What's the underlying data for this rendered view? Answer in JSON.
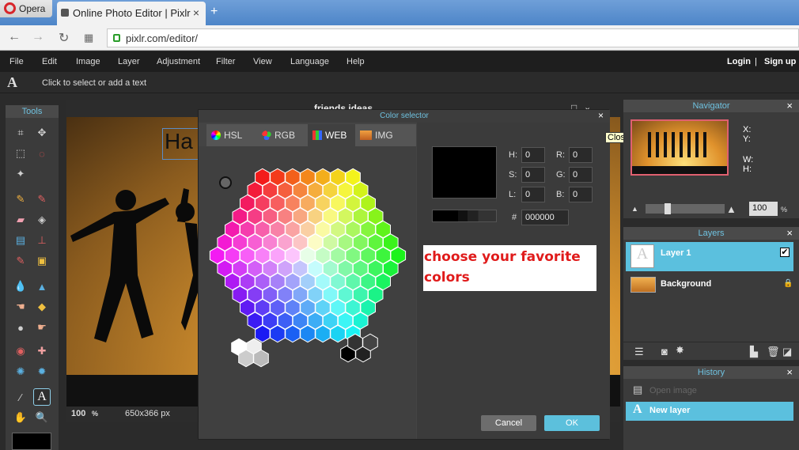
{
  "browser": {
    "opera_label": "Opera",
    "tab_title": "Online Photo Editor | Pixlr",
    "url": "pixlr.com/editor/"
  },
  "menu": {
    "items": [
      "File",
      "Edit",
      "Image",
      "Layer",
      "Adjustment",
      "Filter",
      "View",
      "Language",
      "Help"
    ],
    "login": "Login",
    "separator": "|",
    "signup": "Sign up"
  },
  "optionbar": {
    "tool_glyph": "A",
    "hint": "Click to select or add a text"
  },
  "tools": {
    "title": "Tools"
  },
  "image_window": {
    "title": "friends ideas",
    "text_layer_preview": "Ha",
    "zoom": "100",
    "zoom_unit": "%",
    "size": "650x366 px"
  },
  "color_selector": {
    "title": "Color selector",
    "close": "×",
    "tabs": [
      {
        "label": "HSL",
        "icon": "hsl-wheel-icon"
      },
      {
        "label": "RGB",
        "icon": "rgb-circles-icon"
      },
      {
        "label": "WEB",
        "icon": "web-grid-icon"
      },
      {
        "label": "IMG",
        "icon": "image-icon"
      }
    ],
    "active_tab": "WEB",
    "fields": {
      "h_label": "H:",
      "h": "0",
      "s_label": "S:",
      "s": "0",
      "l_label": "L:",
      "l": "0",
      "r_label": "R:",
      "r": "0",
      "g_label": "G:",
      "g": "0",
      "b_label": "B:",
      "b": "0",
      "hex_label": "#",
      "hex": "000000"
    },
    "preview_color": "#000000",
    "annotation": "choose your favorite colors",
    "cancel": "Cancel",
    "ok": "OK",
    "close_tooltip": "Close"
  },
  "navigator": {
    "title": "Navigator",
    "x_label": "X:",
    "y_label": "Y:",
    "w_label": "W:",
    "h_label": "H:",
    "zoom": "100",
    "zoom_unit": "%"
  },
  "layers": {
    "title": "Layers",
    "items": [
      {
        "name": "Layer 1",
        "selected": true
      },
      {
        "name": "Background",
        "locked": true
      }
    ]
  },
  "history": {
    "title": "History",
    "items": [
      {
        "name": "Open image"
      },
      {
        "name": "New layer",
        "selected": true
      }
    ]
  },
  "colors": {
    "accent": "#5bc0de",
    "dialog_bg": "#444444",
    "ok_button": "#5cc0dc",
    "cancel_button": "#6d6d6d"
  }
}
